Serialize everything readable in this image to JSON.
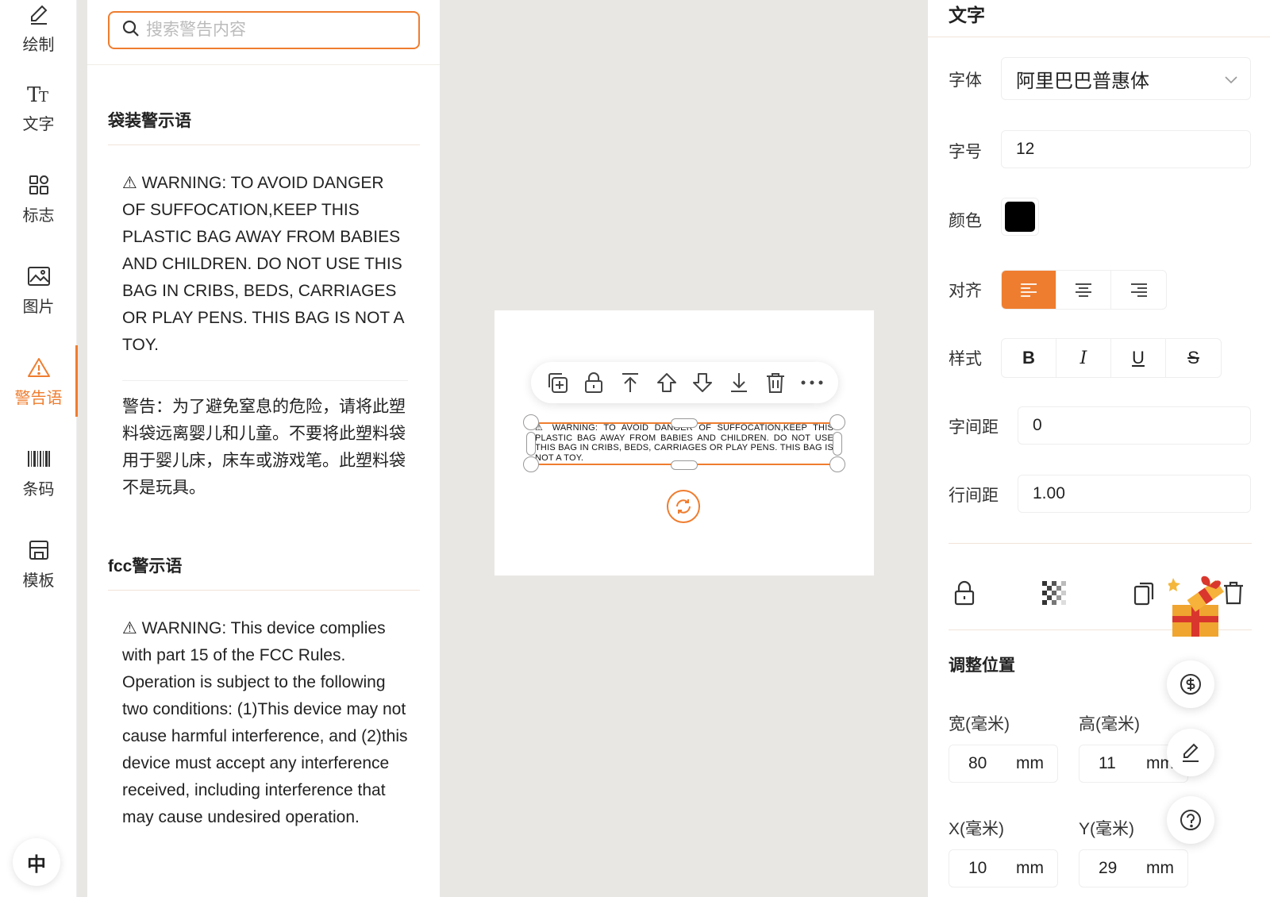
{
  "rail": {
    "items": [
      {
        "label": "绘制",
        "icon": "pencil-icon"
      },
      {
        "label": "文字",
        "icon": "text-icon"
      },
      {
        "label": "标志",
        "icon": "grid-icon"
      },
      {
        "label": "图片",
        "icon": "image-icon"
      },
      {
        "label": "警告语",
        "icon": "warning-icon",
        "active": true
      },
      {
        "label": "条码",
        "icon": "barcode-icon"
      },
      {
        "label": "模板",
        "icon": "store-icon"
      }
    ],
    "lang": "中"
  },
  "warnings": {
    "search_placeholder": "搜索警告内容",
    "sections": [
      {
        "title": "袋装警示语",
        "items": [
          "⚠ WARNING: TO AVOID DANGER OF SUFFOCATION,KEEP THIS PLASTIC BAG AWAY FROM BABIES AND CHILDREN. DO NOT USE THIS BAG IN CRIBS, BEDS, CARRIAGES OR PLAY PENS. THIS BAG IS NOT A TOY.",
          "警告：为了避免窒息的危险，请将此塑料袋远离婴儿和儿童。不要将此塑料袋用于婴儿床，床车或游戏笔。此塑料袋不是玩具。"
        ]
      },
      {
        "title": "fcc警示语",
        "items": [
          "⚠ WARNING: This device complies with part 15 of the FCC Rules. Operation is subject to the following two conditions: (1)This device may not cause harmful interference, and (2)this device must accept any interference received, including interference that may cause undesired operation."
        ]
      }
    ]
  },
  "canvas": {
    "selected_text": "⚠ WARNING: TO AVOID DANGER OF SUFFOCATION,KEEP THIS PLASTIC BAG AWAY FROM BABIES AND CHILDREN. DO NOT USE THIS BAG IN CRIBS, BEDS, CARRIAGES OR PLAY PENS. THIS BAG IS NOT A TOY."
  },
  "props": {
    "title": "文字",
    "font_label": "字体",
    "font_value": "阿里巴巴普惠体",
    "size_label": "字号",
    "size_value": "12",
    "color_label": "颜色",
    "color_value": "#000000",
    "align_label": "对齐",
    "style_label": "样式",
    "style_buttons": [
      "B",
      "I",
      "U",
      "S"
    ],
    "letter_spacing_label": "字间距",
    "letter_spacing_value": "0",
    "line_spacing_label": "行间距",
    "line_spacing_value": "1.00",
    "position_title": "调整位置",
    "width_label": "宽(毫米)",
    "width_value": "80",
    "height_label": "高(毫米)",
    "height_value": "11",
    "x_label": "X(毫米)",
    "x_value": "10",
    "y_label": "Y(毫米)",
    "y_value": "29",
    "unit": "mm"
  },
  "colors": {
    "accent": "#ef7d2f"
  }
}
